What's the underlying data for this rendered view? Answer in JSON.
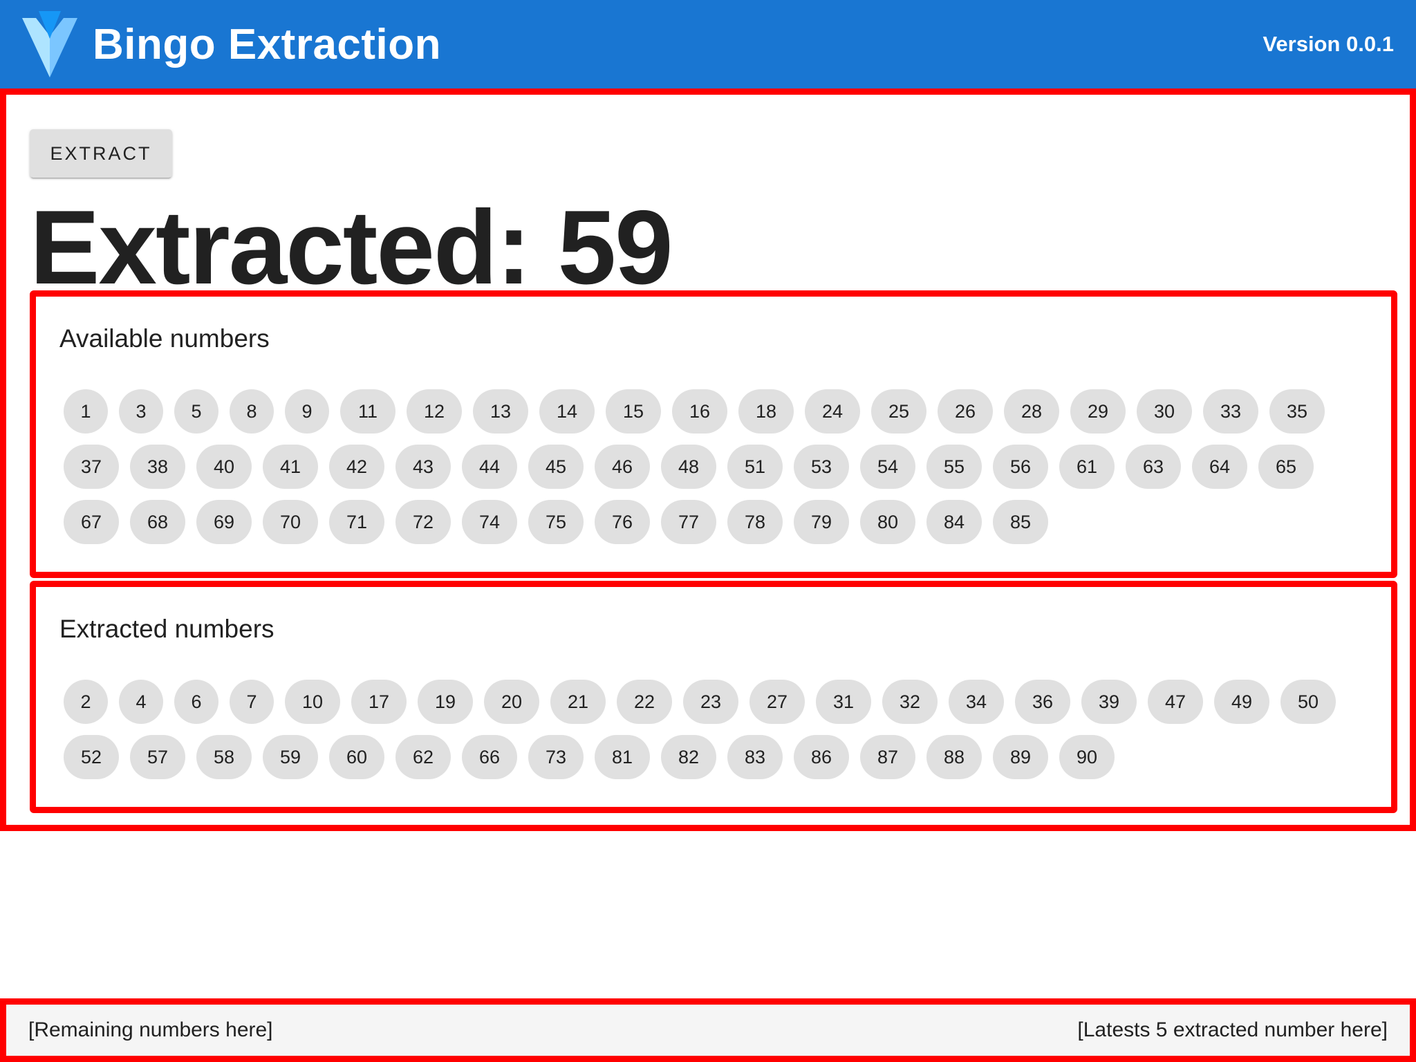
{
  "header": {
    "title": "Bingo Extraction",
    "version": "Version 0.0.1",
    "logo_icon": "vuetify-logo-icon"
  },
  "main": {
    "extract_button_label": "EXTRACT",
    "extracted_prefix": "Extracted: ",
    "extracted_value": "59"
  },
  "available": {
    "title": "Available numbers",
    "numbers": [
      "1",
      "3",
      "5",
      "8",
      "9",
      "11",
      "12",
      "13",
      "14",
      "15",
      "16",
      "18",
      "24",
      "25",
      "26",
      "28",
      "29",
      "30",
      "33",
      "35",
      "37",
      "38",
      "40",
      "41",
      "42",
      "43",
      "44",
      "45",
      "46",
      "48",
      "51",
      "53",
      "54",
      "55",
      "56",
      "61",
      "63",
      "64",
      "65",
      "67",
      "68",
      "69",
      "70",
      "71",
      "72",
      "74",
      "75",
      "76",
      "77",
      "78",
      "79",
      "80",
      "84",
      "85"
    ]
  },
  "extracted": {
    "title": "Extracted numbers",
    "numbers": [
      "2",
      "4",
      "6",
      "7",
      "10",
      "17",
      "19",
      "20",
      "21",
      "22",
      "23",
      "27",
      "31",
      "32",
      "34",
      "36",
      "39",
      "47",
      "49",
      "50",
      "52",
      "57",
      "58",
      "59",
      "60",
      "62",
      "66",
      "73",
      "81",
      "82",
      "83",
      "86",
      "87",
      "88",
      "89",
      "90"
    ]
  },
  "footer": {
    "left_text": "[Remaining numbers here]",
    "right_text": "[Latests 5 extracted number here]"
  },
  "colors": {
    "app_bar": "#1976d2",
    "outline": "#ff0000",
    "chip": "#e0e0e0",
    "footer_bg": "#f5f5f5"
  }
}
